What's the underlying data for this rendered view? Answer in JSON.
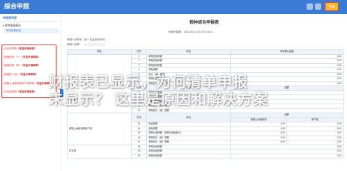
{
  "app": {
    "title": "综合申报",
    "declare_button": "申报",
    "colors": {
      "primary": "#3a7bd5",
      "highlight": "#e53935",
      "button": "#f7b733"
    }
  },
  "sidebar": {
    "title": "申报表列表",
    "group": "财务报表报送",
    "active_item": "财务报表报送",
    "items": [
      {
        "label": "企业所得税",
        "tag": "（未显示清单表）"
      },
      {
        "label": "增值税税（一）",
        "tag": "（未显示清单表）"
      },
      {
        "label": "增值税税（附）",
        "tag": "（未显示清单表）"
      },
      {
        "label": "增值税（四）",
        "tag": "（未显示清单表）"
      },
      {
        "label": "城镇土地使用税房产税申报",
        "tag": "（未显示清单表）"
      },
      {
        "label": "印花税申报",
        "tag": "（未显示清单表）"
      }
    ]
  },
  "report": {
    "title": "税种综合申报表",
    "period_label": "税款所属期：",
    "period_start": "2020-06-01",
    "period_to": "至",
    "period_end": "2020-06-11",
    "taxpayer_id_label": "纳税人识别号（统一社会信用代码）：",
    "taxpayer_name_label": "纳税人名称："
  },
  "table": {
    "headers": [
      "项目",
      "栏次",
      "项目",
      "本年累计金额"
    ],
    "rows": [
      [
        "",
        "1",
        "本期应纳税额",
        "0.00"
      ],
      [
        "",
        "2",
        "本期应纳税额",
        "0.00"
      ],
      [
        "",
        "3",
        "本期应纳税额",
        "0.00"
      ],
      [
        "",
        "4",
        "减免税额",
        "0.00"
      ],
      [
        "",
        "5",
        "应补（退）税额",
        "0.00"
      ],
      [
        "",
        "6",
        "本期已缴税额",
        "0.00"
      ],
      [
        "",
        "7",
        "本期应补（退）税额",
        "0.00"
      ]
    ],
    "group_label_2": "第二部分",
    "group_rows_2": [
      [
        "栏次",
        "项目",
        "金额"
      ],
      [
        "8",
        "本期应纳税额",
        ""
      ],
      [
        "9",
        "本期应纳税额",
        ""
      ],
      [
        "10",
        "本期已缴税额",
        ""
      ],
      [
        "11",
        "本期应补（退）税额",
        ""
      ],
      [
        "12",
        "本期应补（退）税额",
        ""
      ]
    ],
    "group_label_3": "城镇土地使用税房产税",
    "group_header_3": [
      "栏次",
      "项目",
      "金额",
      "城镇土地使用税",
      "房产税"
    ],
    "group_rows_3": [
      [
        "13",
        "应纳税额",
        "0.00",
        "0.00"
      ],
      [
        "14",
        "减免税额",
        "0.00",
        "0.00"
      ],
      [
        "15",
        "本期已缴税额（本期已缴纳部分）",
        "0.00",
        "0.00"
      ],
      [
        "16",
        "本期应补（退）税额",
        "0.00",
        "0.00"
      ],
      [
        "17",
        "本期应补（退）税额",
        "0.00",
        "0.00"
      ]
    ],
    "group_label_4": "印花税",
    "group_rows_4": [
      [
        "18",
        "本期应纳税额",
        "0.00"
      ],
      [
        "19",
        "本期应纳税额",
        "0.00"
      ],
      [
        "20",
        "本期应纳税额",
        "0.00"
      ]
    ]
  },
  "watermark": {
    "line1": "财报表已显示，为何清单申报",
    "line2": "未显示？  这里是原因和解决方案"
  }
}
